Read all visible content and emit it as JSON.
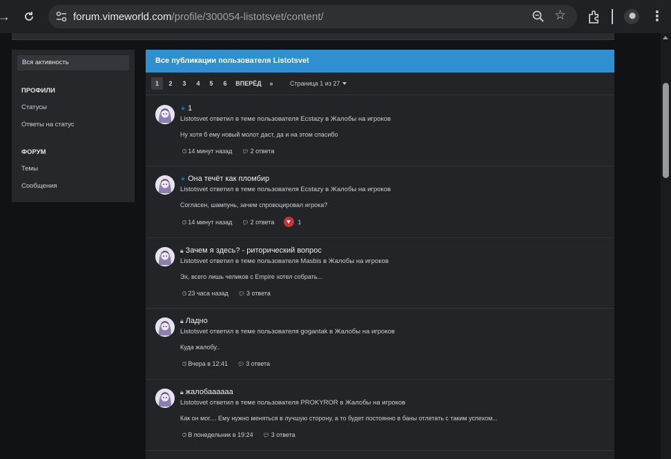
{
  "browser": {
    "url_host": "forum.vimeworld.com",
    "url_path": "/profile/300054-listotsvet/content/"
  },
  "sidebar": {
    "active": "Вся активность",
    "sections": [
      {
        "heading": "ПРОФИЛИ",
        "items": [
          "Статусы",
          "Ответы на статус"
        ]
      },
      {
        "heading": "ФОРУМ",
        "items": [
          "Темы",
          "Сообщения"
        ]
      }
    ]
  },
  "main": {
    "title": "Все публикации пользователя Listotsvet",
    "pagination": {
      "pages": [
        "1",
        "2",
        "3",
        "4",
        "5",
        "6"
      ],
      "current": "1",
      "next": "ВПЕРЁД",
      "last": "»",
      "info": "Страница 1 из 27"
    },
    "posts": [
      {
        "icon": "star",
        "title": "1",
        "subtitle": "Listotsvet ответил в теме пользователя Ecstazy в Жалобы на игроков",
        "snippet": "Ну хотя б ему новый молот даст, да и на этом спасибо",
        "time": "14 минут назад",
        "replies": "2 ответа",
        "reactions": ""
      },
      {
        "icon": "star",
        "title": "Она течёт как пломбир",
        "subtitle": "Listotsvet ответил в теме пользователя Ecstazy в Жалобы на игроков",
        "snippet": "Согласен, шампунь, зачем спровоцировал игрока?",
        "time": "14 минут назад",
        "replies": "2 ответа",
        "reactions": "1"
      },
      {
        "icon": "lock",
        "title": "Зачем я здесь? - риторический вопрос",
        "subtitle": "Listotsvet ответил в теме пользователя Masbis в Жалобы на игроков",
        "snippet": "Эх, всего лишь челиков с Empire хотел собрать...",
        "time": "23 часа назад",
        "replies": "3 ответа",
        "reactions": ""
      },
      {
        "icon": "lock",
        "title": "Ладно",
        "subtitle": "Listotsvet ответил в теме пользователя gogantak в Жалобы на игроков",
        "snippet": "Куда жалобу..",
        "time": "Вчера в 12:41",
        "replies": "3 ответа",
        "reactions": ""
      },
      {
        "icon": "lock",
        "title": "жалобаааааа",
        "subtitle": "Listotsvet ответил в теме пользователя PROKYROR в Жалобы на игроков",
        "snippet": "Как он мог.... Ему нужно меняться в лучшую сторону, а то будет постоянно в баны отлетать с таким успехом...",
        "time": "В понедельник в 19:24",
        "replies": "3 ответа",
        "reactions": ""
      }
    ]
  }
}
